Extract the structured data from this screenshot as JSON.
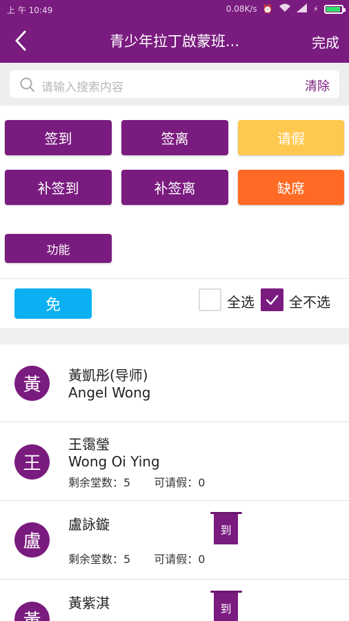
{
  "status_bar": {
    "time": "上 午 10:49",
    "speed": "0.08K/s",
    "network": "4G"
  },
  "header": {
    "title": "青少年拉丁啟蒙班...",
    "done_label": "完成"
  },
  "search": {
    "placeholder": "请输入搜索内容",
    "clear_label": "清除"
  },
  "actions": {
    "sign_in": "签到",
    "sign_out": "签离",
    "leave": "请假",
    "makeup_sign_in": "补签到",
    "makeup_sign_out": "补签离",
    "absent": "缺席",
    "function": "功能",
    "exempt": "免"
  },
  "selection": {
    "select_all": "全选",
    "select_none": "全不选",
    "select_all_checked": false,
    "select_none_checked": true
  },
  "colors": {
    "brand": "#7a1b7f",
    "leave": "#ffc94f",
    "absent": "#ff6b24",
    "exempt": "#0ab0f2"
  },
  "students": [
    {
      "avatar": "黃",
      "name_cn": "黃凱彤(导师)",
      "name_en": "Angel Wong"
    },
    {
      "avatar": "王",
      "name_cn": "王霭瑩",
      "name_en": "Wong Oi Ying",
      "remaining_label": "剩余堂数：5",
      "leave_label": "可请假：0"
    },
    {
      "avatar": "盧",
      "name_cn": "盧詠鏇",
      "remaining_label": "剩余堂数：5",
      "leave_label": "可请假：0",
      "status": "到"
    },
    {
      "avatar": "黃",
      "name_cn": "黃紫淇",
      "status": "到"
    }
  ]
}
